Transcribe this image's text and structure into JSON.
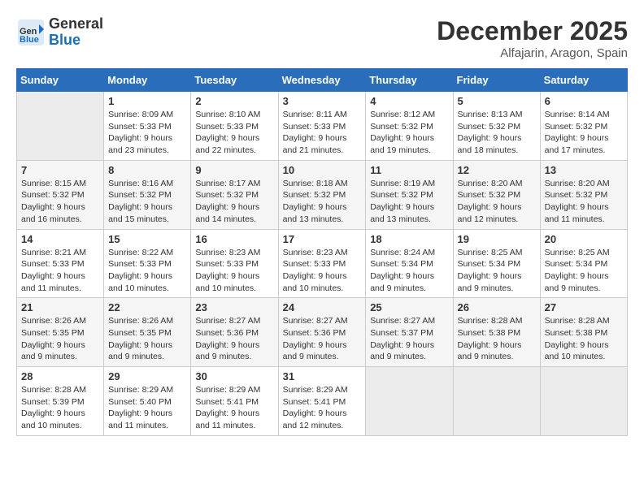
{
  "header": {
    "logo": {
      "general": "General",
      "blue": "Blue"
    },
    "month": "December 2025",
    "location": "Alfajarin, Aragon, Spain"
  },
  "weekdays": [
    "Sunday",
    "Monday",
    "Tuesday",
    "Wednesday",
    "Thursday",
    "Friday",
    "Saturday"
  ],
  "weeks": [
    [
      {
        "day": "",
        "empty": true
      },
      {
        "day": "1",
        "sunrise": "8:09 AM",
        "sunset": "5:33 PM",
        "daylight": "9 hours and 23 minutes."
      },
      {
        "day": "2",
        "sunrise": "8:10 AM",
        "sunset": "5:33 PM",
        "daylight": "9 hours and 22 minutes."
      },
      {
        "day": "3",
        "sunrise": "8:11 AM",
        "sunset": "5:33 PM",
        "daylight": "9 hours and 21 minutes."
      },
      {
        "day": "4",
        "sunrise": "8:12 AM",
        "sunset": "5:32 PM",
        "daylight": "9 hours and 19 minutes."
      },
      {
        "day": "5",
        "sunrise": "8:13 AM",
        "sunset": "5:32 PM",
        "daylight": "9 hours and 18 minutes."
      },
      {
        "day": "6",
        "sunrise": "8:14 AM",
        "sunset": "5:32 PM",
        "daylight": "9 hours and 17 minutes."
      }
    ],
    [
      {
        "day": "7",
        "sunrise": "8:15 AM",
        "sunset": "5:32 PM",
        "daylight": "9 hours and 16 minutes."
      },
      {
        "day": "8",
        "sunrise": "8:16 AM",
        "sunset": "5:32 PM",
        "daylight": "9 hours and 15 minutes."
      },
      {
        "day": "9",
        "sunrise": "8:17 AM",
        "sunset": "5:32 PM",
        "daylight": "9 hours and 14 minutes."
      },
      {
        "day": "10",
        "sunrise": "8:18 AM",
        "sunset": "5:32 PM",
        "daylight": "9 hours and 13 minutes."
      },
      {
        "day": "11",
        "sunrise": "8:19 AM",
        "sunset": "5:32 PM",
        "daylight": "9 hours and 13 minutes."
      },
      {
        "day": "12",
        "sunrise": "8:20 AM",
        "sunset": "5:32 PM",
        "daylight": "9 hours and 12 minutes."
      },
      {
        "day": "13",
        "sunrise": "8:20 AM",
        "sunset": "5:32 PM",
        "daylight": "9 hours and 11 minutes."
      }
    ],
    [
      {
        "day": "14",
        "sunrise": "8:21 AM",
        "sunset": "5:33 PM",
        "daylight": "9 hours and 11 minutes."
      },
      {
        "day": "15",
        "sunrise": "8:22 AM",
        "sunset": "5:33 PM",
        "daylight": "9 hours and 10 minutes."
      },
      {
        "day": "16",
        "sunrise": "8:23 AM",
        "sunset": "5:33 PM",
        "daylight": "9 hours and 10 minutes."
      },
      {
        "day": "17",
        "sunrise": "8:23 AM",
        "sunset": "5:33 PM",
        "daylight": "9 hours and 10 minutes."
      },
      {
        "day": "18",
        "sunrise": "8:24 AM",
        "sunset": "5:34 PM",
        "daylight": "9 hours and 9 minutes."
      },
      {
        "day": "19",
        "sunrise": "8:25 AM",
        "sunset": "5:34 PM",
        "daylight": "9 hours and 9 minutes."
      },
      {
        "day": "20",
        "sunrise": "8:25 AM",
        "sunset": "5:34 PM",
        "daylight": "9 hours and 9 minutes."
      }
    ],
    [
      {
        "day": "21",
        "sunrise": "8:26 AM",
        "sunset": "5:35 PM",
        "daylight": "9 hours and 9 minutes."
      },
      {
        "day": "22",
        "sunrise": "8:26 AM",
        "sunset": "5:35 PM",
        "daylight": "9 hours and 9 minutes."
      },
      {
        "day": "23",
        "sunrise": "8:27 AM",
        "sunset": "5:36 PM",
        "daylight": "9 hours and 9 minutes."
      },
      {
        "day": "24",
        "sunrise": "8:27 AM",
        "sunset": "5:36 PM",
        "daylight": "9 hours and 9 minutes."
      },
      {
        "day": "25",
        "sunrise": "8:27 AM",
        "sunset": "5:37 PM",
        "daylight": "9 hours and 9 minutes."
      },
      {
        "day": "26",
        "sunrise": "8:28 AM",
        "sunset": "5:38 PM",
        "daylight": "9 hours and 9 minutes."
      },
      {
        "day": "27",
        "sunrise": "8:28 AM",
        "sunset": "5:38 PM",
        "daylight": "9 hours and 10 minutes."
      }
    ],
    [
      {
        "day": "28",
        "sunrise": "8:28 AM",
        "sunset": "5:39 PM",
        "daylight": "9 hours and 10 minutes."
      },
      {
        "day": "29",
        "sunrise": "8:29 AM",
        "sunset": "5:40 PM",
        "daylight": "9 hours and 11 minutes."
      },
      {
        "day": "30",
        "sunrise": "8:29 AM",
        "sunset": "5:41 PM",
        "daylight": "9 hours and 11 minutes."
      },
      {
        "day": "31",
        "sunrise": "8:29 AM",
        "sunset": "5:41 PM",
        "daylight": "9 hours and 12 minutes."
      },
      {
        "day": "",
        "empty": true
      },
      {
        "day": "",
        "empty": true
      },
      {
        "day": "",
        "empty": true
      }
    ]
  ]
}
